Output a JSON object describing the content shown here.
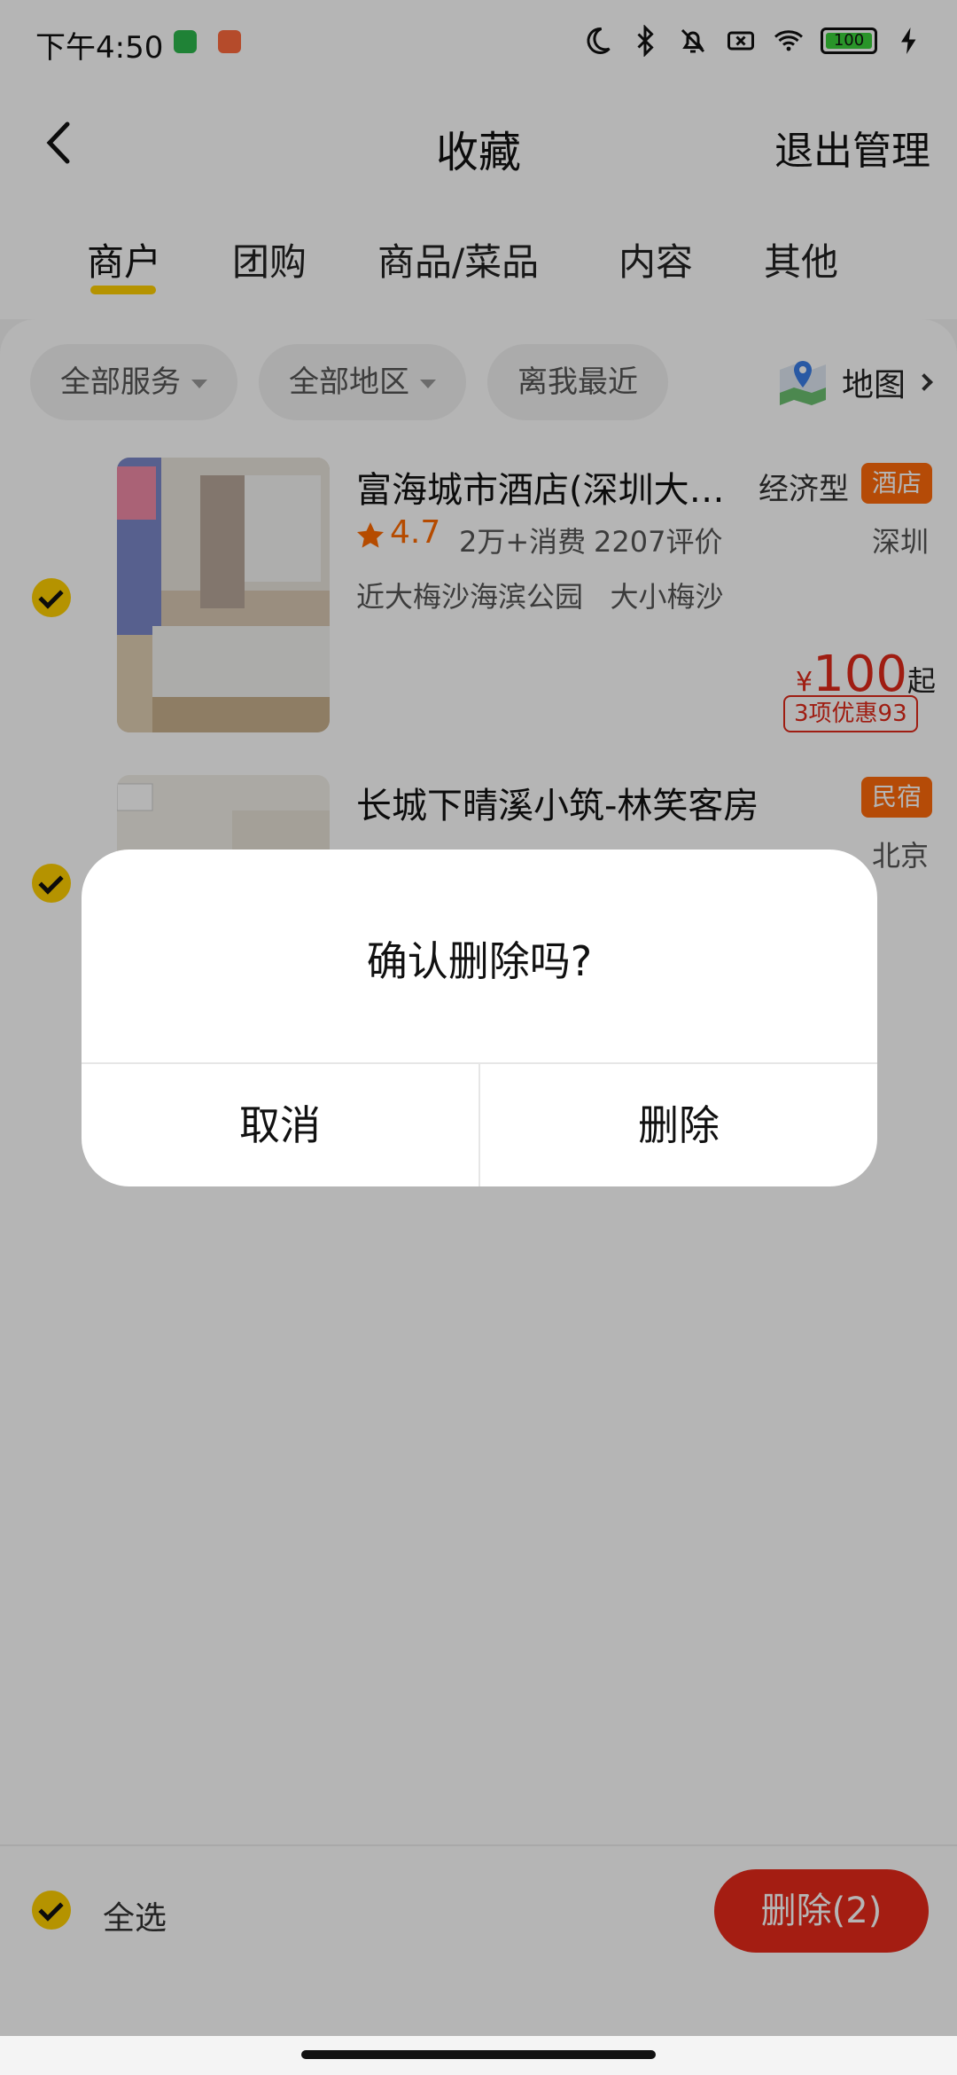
{
  "status_bar": {
    "time": "下午4:50",
    "battery": "100"
  },
  "header": {
    "title": "收藏",
    "exit_label": "退出管理"
  },
  "tabs": [
    {
      "label": "商户"
    },
    {
      "label": "团购"
    },
    {
      "label": "商品/菜品"
    },
    {
      "label": "内容"
    },
    {
      "label": "其他"
    }
  ],
  "filters": {
    "services": "全部服务",
    "regions": "全部地区",
    "nearest": "离我最近",
    "map": "地图"
  },
  "items": [
    {
      "name": "富海城市酒店(深圳大…",
      "type": "经济型",
      "badge": "酒店",
      "rating": "4.7",
      "spend": "2万+消费",
      "reviews": "2207评价",
      "city": "深圳",
      "tags": "近大梅沙海滨公园   大小梅沙",
      "price_currency": "¥",
      "price": "100",
      "price_suffix": "起",
      "promo": "3项优惠93"
    },
    {
      "name": "长城下晴溪小筑-林笑客房",
      "badge": "民宿",
      "city": "北京"
    }
  ],
  "dialog": {
    "message": "确认删除吗?",
    "cancel": "取消",
    "confirm": "删除"
  },
  "bottom_bar": {
    "select_all": "全选",
    "delete_button": "删除(2)"
  },
  "colors": {
    "accent_yellow": "#ffd000",
    "delete_red": "#e82a1a",
    "badge_orange": "#ff6a0a"
  }
}
